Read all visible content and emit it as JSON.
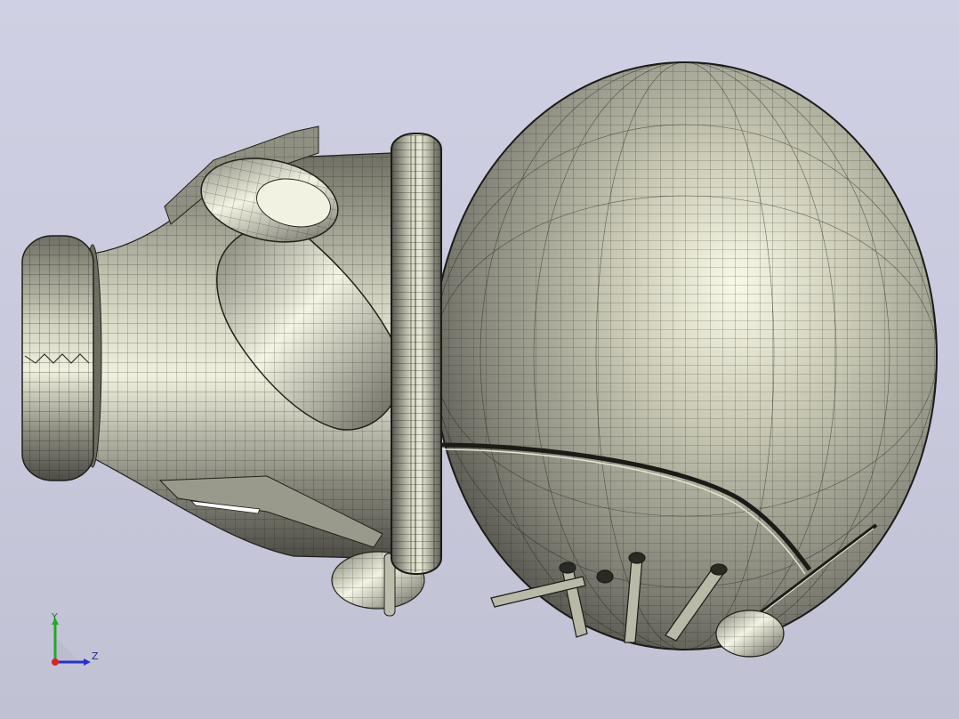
{
  "viewport": {
    "background_top": "#cfd0e3",
    "background_bottom": "#c0c1d3",
    "model_fill": "#a7a795",
    "mesh_color": "#20201a"
  },
  "triad": {
    "y_label": "Y",
    "z_label": "Z",
    "y_color": "#22aa22",
    "z_color": "#2233cc",
    "x_color": "#dd2222"
  }
}
